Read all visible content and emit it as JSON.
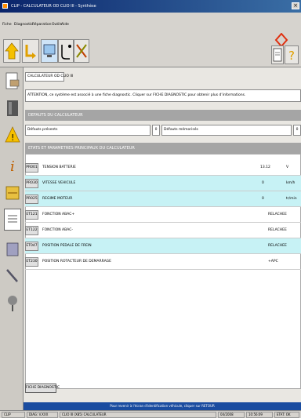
{
  "window": {
    "title": "CLIP - CALCULATEUR OD CLIO III - Synthèse"
  },
  "menu": [
    "Fiche",
    "Diagnostic",
    "Réparation",
    "Outils",
    "Aide"
  ],
  "tab": {
    "label": "CALCULATEUR OD CLIO III"
  },
  "attention": "ATTENTION, ce système est associé à une fiche diagnostic. Cliquer sur FICHE DIAGNOSTIC pour obtenir plus d'informations.",
  "sections": {
    "defauts": "DEFAUTS DU CALCULATEUR",
    "etats": "ETATS ET PARAMETRES PRINCIPAUX DU CALCULATEUR"
  },
  "defauts": {
    "presents_label": "Défauts présents",
    "presents_count": "0",
    "memorises_label": "Défauts mémorisés",
    "memorises_count": "0"
  },
  "parameters": [
    {
      "code": "PR001",
      "desc": "TENSION BATTERIE",
      "value": "13.12",
      "unit": "V",
      "cyan": false
    },
    {
      "code": "PR030",
      "desc": "VITESSE VEHICULE",
      "value": "0",
      "unit": "km/h",
      "cyan": true
    },
    {
      "code": "PR025",
      "desc": "REGIME MOTEUR",
      "value": "0",
      "unit": "tr/min",
      "cyan": true
    },
    {
      "code": "ET121",
      "desc": "FONCTION ABAC+",
      "value": "RELACHEE",
      "unit": "",
      "cyan": false
    },
    {
      "code": "ET122",
      "desc": "FONCTION ABAC-",
      "value": "RELACHEE",
      "unit": "",
      "cyan": false
    },
    {
      "code": "ET047",
      "desc": "POSITION PEDALE DE FREIN",
      "value": "RELACHEE",
      "unit": "",
      "cyan": true
    },
    {
      "code": "ET230",
      "desc": "POSITION ROTACTEUR DE DEMARRAGE",
      "value": "+APC",
      "unit": "",
      "cyan": false
    }
  ],
  "fiche_button": "FICHE DIAGNOSTIC",
  "status_message": "Pour revenir à l'écran d'identification véhicule, cliquer sur RETOUR",
  "statusbar": [
    "CLIP",
    "DIAG: V.XXX",
    "CLIO III (X85) CALCULATEUR",
    "04/2008",
    "10:56:09",
    "ETAT: OK"
  ]
}
